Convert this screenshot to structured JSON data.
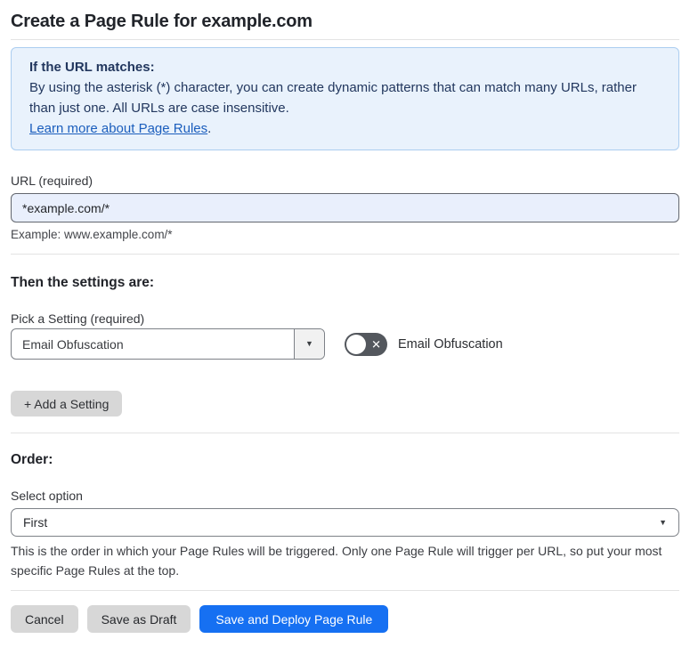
{
  "page": {
    "title": "Create a Page Rule for example.com"
  },
  "info_box": {
    "heading": "If the URL matches:",
    "body": "By using the asterisk (*) character, you can create dynamic patterns that can match many URLs, rather than just one. All URLs are case insensitive.",
    "link_text": "Learn more about Page Rules",
    "link_suffix": "."
  },
  "url_section": {
    "label": "URL (required)",
    "value": "*example.com/*",
    "example": "Example: www.example.com/*"
  },
  "settings_section": {
    "heading": "Then the settings are:",
    "picker_label": "Pick a Setting (required)",
    "picker_value": "Email Obfuscation",
    "toggle_label": "Email Obfuscation",
    "toggle_state": "off",
    "add_button_label": "+ Add a Setting"
  },
  "order_section": {
    "heading": "Order:",
    "select_label": "Select option",
    "select_value": "First",
    "help_text": "This is the order in which your Page Rules will be triggered. Only one Page Rule will trigger per URL, so put your most specific Page Rules at the top."
  },
  "footer": {
    "cancel_label": "Cancel",
    "save_draft_label": "Save as Draft",
    "save_deploy_label": "Save and Deploy Page Rule"
  },
  "colors": {
    "accent_blue": "#1670f2",
    "info_bg": "#e9f2fc",
    "info_border": "#abcdf0",
    "info_text": "#22375e",
    "link_blue": "#1b5ebd",
    "input_bg": "#e9effc"
  }
}
